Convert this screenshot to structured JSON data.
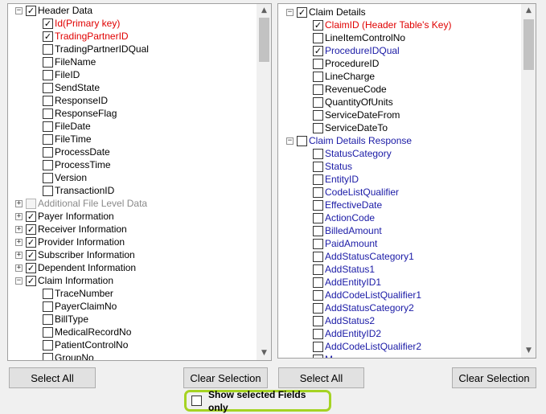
{
  "left_tree": {
    "items": [
      {
        "label": "Header Data",
        "level": 0,
        "expander": "minus",
        "checked": true
      },
      {
        "label": "Id(Primary key)",
        "level": 1,
        "checked": true,
        "color": "red"
      },
      {
        "label": "TradingPartnerID",
        "level": 1,
        "checked": true,
        "color": "red"
      },
      {
        "label": "TradingPartnerIDQual",
        "level": 1,
        "checked": false
      },
      {
        "label": "FileName",
        "level": 1,
        "checked": false
      },
      {
        "label": "FileID",
        "level": 1,
        "checked": false
      },
      {
        "label": "SendState",
        "level": 1,
        "checked": false
      },
      {
        "label": "ResponseID",
        "level": 1,
        "checked": false
      },
      {
        "label": "ResponseFlag",
        "level": 1,
        "checked": false
      },
      {
        "label": "FileDate",
        "level": 1,
        "checked": false
      },
      {
        "label": "FileTime",
        "level": 1,
        "checked": false
      },
      {
        "label": "ProcessDate",
        "level": 1,
        "checked": false
      },
      {
        "label": "ProcessTime",
        "level": 1,
        "checked": false
      },
      {
        "label": "Version",
        "level": 1,
        "checked": false
      },
      {
        "label": "TransactionID",
        "level": 1,
        "checked": false
      },
      {
        "label": "Additional File Level Data",
        "level": 0,
        "expander": "plus",
        "checked": false,
        "disabled": true
      },
      {
        "label": "Payer Information",
        "level": 0,
        "expander": "plus",
        "checked": true
      },
      {
        "label": "Receiver Information",
        "level": 0,
        "expander": "plus",
        "checked": true
      },
      {
        "label": "Provider Information",
        "level": 0,
        "expander": "plus",
        "checked": true
      },
      {
        "label": "Subscriber Information",
        "level": 0,
        "expander": "plus",
        "checked": true
      },
      {
        "label": "Dependent Information",
        "level": 0,
        "expander": "plus",
        "checked": true
      },
      {
        "label": "Claim Information",
        "level": 0,
        "expander": "minus",
        "checked": true
      },
      {
        "label": "TraceNumber",
        "level": 1,
        "checked": false
      },
      {
        "label": "PayerClaimNo",
        "level": 1,
        "checked": false
      },
      {
        "label": "BillType",
        "level": 1,
        "checked": false
      },
      {
        "label": "MedicalRecordNo",
        "level": 1,
        "checked": false
      },
      {
        "label": "PatientControlNo",
        "level": 1,
        "checked": false
      },
      {
        "label": "GroupNo",
        "level": 1,
        "checked": false
      }
    ]
  },
  "right_tree": {
    "items": [
      {
        "label": "Claim Details",
        "level": 0,
        "expander": "minus",
        "checked": true
      },
      {
        "label": "ClaimID (Header Table's Key)",
        "level": 1,
        "checked": true,
        "color": "red"
      },
      {
        "label": "LineItemControlNo",
        "level": 1,
        "checked": false
      },
      {
        "label": "ProcedureIDQual",
        "level": 1,
        "checked": true,
        "color": "navy"
      },
      {
        "label": "ProcedureID",
        "level": 1,
        "checked": false
      },
      {
        "label": "LineCharge",
        "level": 1,
        "checked": false
      },
      {
        "label": "RevenueCode",
        "level": 1,
        "checked": false
      },
      {
        "label": "QuantityOfUnits",
        "level": 1,
        "checked": false
      },
      {
        "label": "ServiceDateFrom",
        "level": 1,
        "checked": false
      },
      {
        "label": "ServiceDateTo",
        "level": 1,
        "checked": false
      },
      {
        "label": "Claim Details Response",
        "level": 0,
        "expander": "minus",
        "checked": false,
        "color": "navy"
      },
      {
        "label": "StatusCategory",
        "level": 1,
        "checked": false,
        "color": "navy"
      },
      {
        "label": "Status",
        "level": 1,
        "checked": false,
        "color": "navy"
      },
      {
        "label": "EntityID",
        "level": 1,
        "checked": false,
        "color": "navy"
      },
      {
        "label": "CodeListQualifier",
        "level": 1,
        "checked": false,
        "color": "navy"
      },
      {
        "label": "EffectiveDate",
        "level": 1,
        "checked": false,
        "color": "navy"
      },
      {
        "label": "ActionCode",
        "level": 1,
        "checked": false,
        "color": "navy"
      },
      {
        "label": "BilledAmount",
        "level": 1,
        "checked": false,
        "color": "navy"
      },
      {
        "label": "PaidAmount",
        "level": 1,
        "checked": false,
        "color": "navy"
      },
      {
        "label": "AddStatusCategory1",
        "level": 1,
        "checked": false,
        "color": "navy"
      },
      {
        "label": "AddStatus1",
        "level": 1,
        "checked": false,
        "color": "navy"
      },
      {
        "label": "AddEntityID1",
        "level": 1,
        "checked": false,
        "color": "navy"
      },
      {
        "label": "AddCodeListQualifier1",
        "level": 1,
        "checked": false,
        "color": "navy"
      },
      {
        "label": "AddStatusCategory2",
        "level": 1,
        "checked": false,
        "color": "navy"
      },
      {
        "label": "AddStatus2",
        "level": 1,
        "checked": false,
        "color": "navy"
      },
      {
        "label": "AddEntityID2",
        "level": 1,
        "checked": false,
        "color": "navy"
      },
      {
        "label": "AddCodeListQualifier2",
        "level": 1,
        "checked": false,
        "color": "navy"
      },
      {
        "label": "M",
        "level": 1,
        "checked": false,
        "color": "navy"
      }
    ]
  },
  "buttons": {
    "left_select_all": "Select All",
    "left_clear": "Clear Selection",
    "right_select_all": "Select All",
    "right_clear": "Clear Selection"
  },
  "show_selected": {
    "label": "Show selected Fields only",
    "checked": false
  },
  "colors": {
    "highlight": "#a5d323",
    "key_field": "#e00000",
    "navy_field": "#1a1aa6"
  }
}
